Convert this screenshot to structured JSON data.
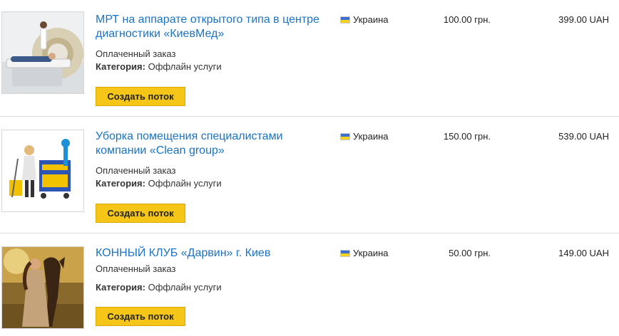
{
  "orders": [
    {
      "title": "МРТ на аппарате открытого типа в центре диагностики «КиевМед»",
      "status": "Оплаченный заказ",
      "category_label": "Категория:",
      "category_value": "Оффлайн услуги",
      "button_label": "Создать поток",
      "country": "Украина",
      "price": "100.00 грн.",
      "total": "399.00 UAH",
      "image_icon": "mri-scanner-photo"
    },
    {
      "title": "Уборка помещения специалистами компании «Clean group»",
      "status": "Оплаченный заказ",
      "category_label": "Категория:",
      "category_value": "Оффлайн услуги",
      "button_label": "Создать поток",
      "country": "Украина",
      "price": "150.00 грн.",
      "total": "539.00 UAH",
      "image_icon": "cleaning-cart-photo"
    },
    {
      "title": "КОННЫЙ КЛУБ «Дарвин» г. Киев",
      "status": "Оплаченный заказ",
      "category_label": "Категория:",
      "category_value": "Оффлайн услуги",
      "button_label": "Создать поток",
      "country": "Украина",
      "price": "50.00 грн.",
      "total": "149.00 UAH",
      "image_icon": "horse-photo"
    }
  ],
  "colors": {
    "link": "#1a73c6",
    "button": "#f5c518",
    "flag_top": "#3a6fd0",
    "flag_bottom": "#f3d21c"
  }
}
